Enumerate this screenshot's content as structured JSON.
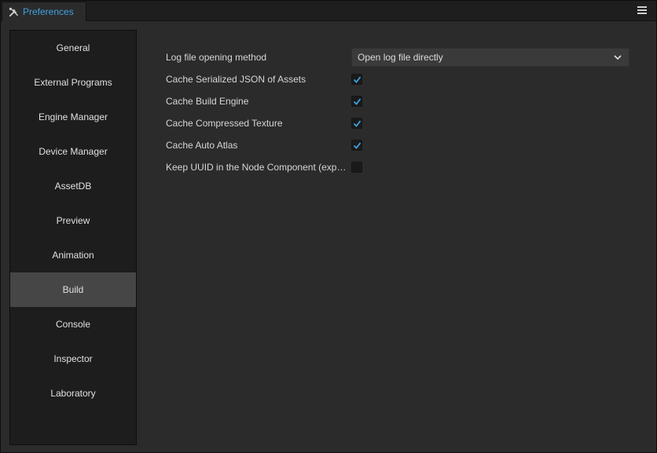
{
  "window": {
    "tab_title": "Preferences"
  },
  "icons": {
    "tab": "tools-icon",
    "menu": "hamburger-menu-icon"
  },
  "colors": {
    "accent": "#3fa2e1",
    "active_item": "#464646"
  },
  "sidebar": {
    "items": [
      {
        "label": "General"
      },
      {
        "label": "External Programs"
      },
      {
        "label": "Engine Manager"
      },
      {
        "label": "Device Manager"
      },
      {
        "label": "AssetDB"
      },
      {
        "label": "Preview"
      },
      {
        "label": "Animation"
      },
      {
        "label": "Build"
      },
      {
        "label": "Console"
      },
      {
        "label": "Inspector"
      },
      {
        "label": "Laboratory"
      }
    ],
    "active": "Build"
  },
  "build": {
    "log_method": {
      "label": "Log file opening method",
      "value": "Open log file directly"
    },
    "cache_json": {
      "label": "Cache Serialized JSON of Assets",
      "checked": true
    },
    "cache_engine": {
      "label": "Cache Build Engine",
      "checked": true
    },
    "cache_texture": {
      "label": "Cache Compressed Texture",
      "checked": true
    },
    "cache_atlas": {
      "label": "Cache Auto Atlas",
      "checked": true
    },
    "keep_uuid": {
      "label": "Keep UUID in the Node Component (experimental)",
      "checked": false
    }
  }
}
